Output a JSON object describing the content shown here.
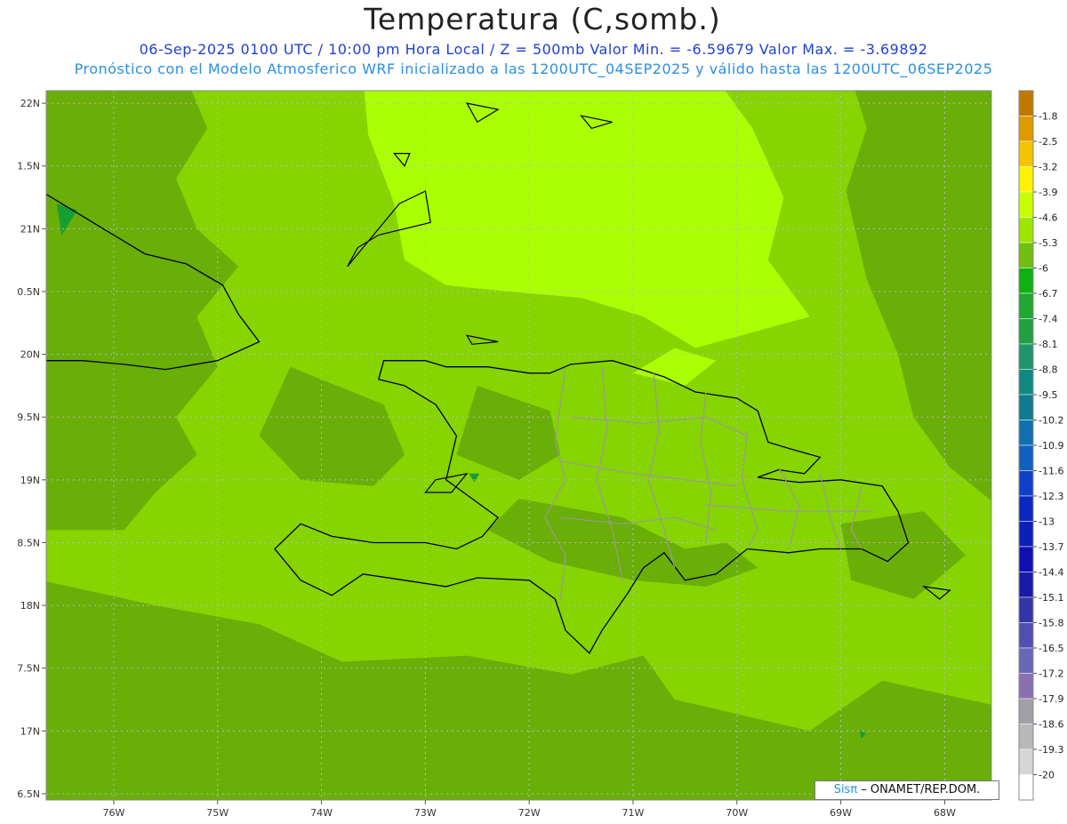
{
  "header": {
    "title": "Temperatura (C,somb.)",
    "subtitle1": "06-Sep-2025  0100 UTC / 10:00 pm Hora Local / Z = 500mb  Valor Min. = -6.59679  Valor Max. = -3.69892",
    "subtitle2": "Pronóstico con el Modelo Atmosferico WRF inicializado a las 1200UTC_04SEP2025 y válido hasta las  1200UTC_06SEP2025"
  },
  "chart_data": {
    "type": "heatmap",
    "variable": "Temperatura (C,somb.)",
    "level": "500mb",
    "valid_time": "06-Sep-2025 0100 UTC",
    "value_min": -6.59679,
    "value_max": -3.69892,
    "lon_range": [
      -76.65,
      -67.55
    ],
    "lat_range": [
      16.45,
      22.1
    ],
    "x_ticks": [
      "76W",
      "75W",
      "74W",
      "73W",
      "72W",
      "71W",
      "70W",
      "69W",
      "68W"
    ],
    "x_tick_values": [
      -76,
      -75,
      -74,
      -73,
      -72,
      -71,
      -70,
      -69,
      -68
    ],
    "y_ticks": [
      "22N",
      "1.5N",
      "21N",
      "0.5N",
      "20N",
      "9.5N",
      "19N",
      "8.5N",
      "18N",
      "7.5N",
      "17N",
      "6.5N"
    ],
    "y_tick_values": [
      22,
      21.5,
      21,
      20.5,
      20,
      19.5,
      19,
      18.5,
      18,
      17.5,
      17,
      16.5
    ],
    "legend": {
      "placement": "right",
      "labels": [
        "-1.8",
        "-2.5",
        "-3.2",
        "-3.9",
        "-4.6",
        "-5.3",
        "-6",
        "-6.7",
        "-7.4",
        "-8.1",
        "-8.8",
        "-9.5",
        "-10.2",
        "-10.9",
        "-11.6",
        "-12.3",
        "-13",
        "-13.7",
        "-14.4",
        "-15.1",
        "-15.8",
        "-16.5",
        "-17.2",
        "-17.9",
        "-18.6",
        "-19.3",
        "-20"
      ],
      "colors": [
        "#c07800",
        "#e09a00",
        "#f5c400",
        "#fff200",
        "#c8ff00",
        "#9ee600",
        "#6fbf10",
        "#10b010",
        "#20a830",
        "#20a040",
        "#20946a",
        "#108a80",
        "#107a90",
        "#1070b0",
        "#1060c0",
        "#1040c8",
        "#0a28c0",
        "#0a20b8",
        "#1010b0",
        "#1a1aa8",
        "#3434a8",
        "#5050b0",
        "#6868b8",
        "#8a70b0",
        "#a0a0a8",
        "#b8b8b8",
        "#d6d6d6",
        "#ffffff"
      ]
    },
    "field_colors": {
      "warm": "#aaff00",
      "mid": "#86d400",
      "cool": "#6aae08",
      "coldest": "#159f33"
    },
    "grid": true
  },
  "credit": {
    "logo": "Sisπ",
    "text": " – ONAMET/REP.DOM."
  }
}
